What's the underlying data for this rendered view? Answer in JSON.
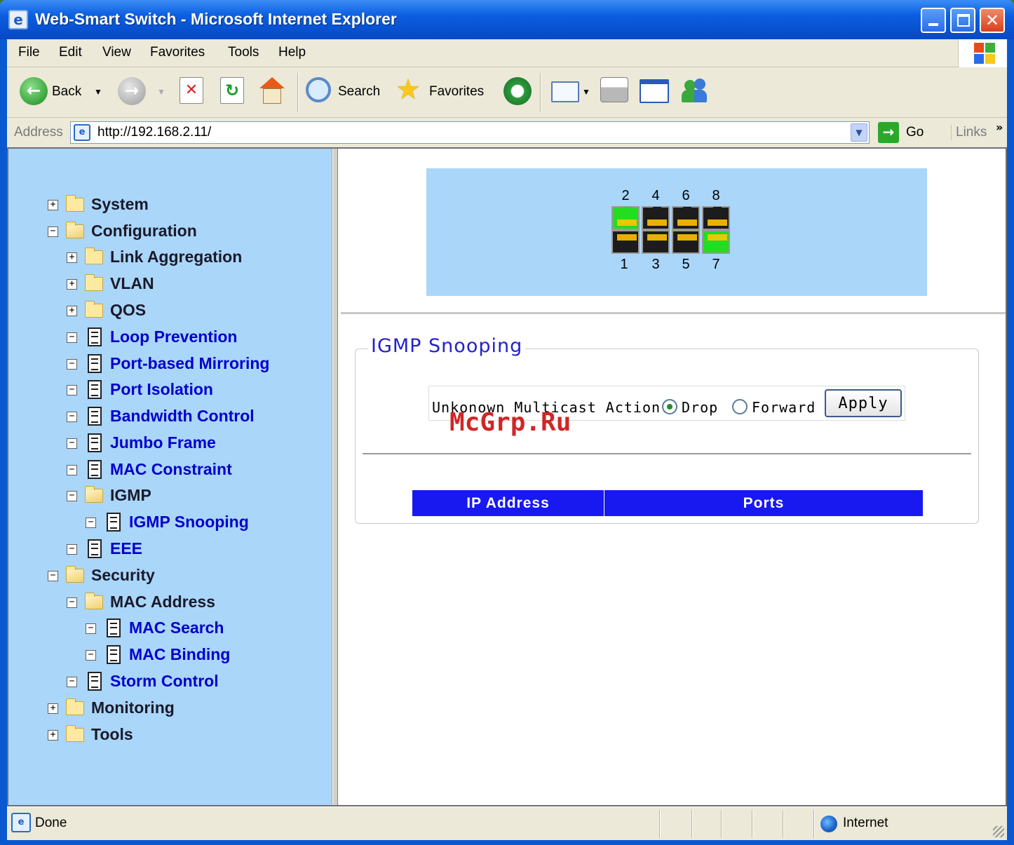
{
  "window": {
    "title": "Web-Smart Switch - Microsoft Internet Explorer"
  },
  "menu": [
    "File",
    "Edit",
    "View",
    "Favorites",
    "Tools",
    "Help"
  ],
  "toolbar": {
    "back": "Back",
    "search": "Search",
    "favorites": "Favorites"
  },
  "address": {
    "label": "Address",
    "url": "http://192.168.2.11/",
    "go": "Go",
    "links": "Links"
  },
  "tree": [
    {
      "label": "System"
    },
    {
      "label": "Configuration"
    },
    {
      "label": "Link Aggregation"
    },
    {
      "label": "VLAN"
    },
    {
      "label": "QOS"
    },
    {
      "label": "Loop Prevention"
    },
    {
      "label": "Port-based Mirroring"
    },
    {
      "label": "Port Isolation"
    },
    {
      "label": "Bandwidth Control"
    },
    {
      "label": "Jumbo Frame"
    },
    {
      "label": "MAC Constraint"
    },
    {
      "label": "IGMP"
    },
    {
      "label": "IGMP Snooping"
    },
    {
      "label": "EEE"
    },
    {
      "label": "Security"
    },
    {
      "label": "MAC Address"
    },
    {
      "label": "MAC Search"
    },
    {
      "label": "MAC Binding"
    },
    {
      "label": "Storm Control"
    },
    {
      "label": "Monitoring"
    },
    {
      "label": "Tools"
    }
  ],
  "ports": {
    "top": [
      "2",
      "4",
      "6",
      "8"
    ],
    "bottom": [
      "1",
      "3",
      "5",
      "7"
    ],
    "link_color": "#22dd22"
  },
  "igmp": {
    "legend": "IGMP Snooping",
    "action_label": "Unkonown Multicast Action:",
    "drop": "Drop",
    "forward": "Forward",
    "selected": "Drop",
    "apply": "Apply",
    "columns": [
      "IP Address",
      "Ports"
    ]
  },
  "watermark": "McGrp.Ru",
  "status": {
    "text": "Done",
    "zone": "Internet"
  }
}
